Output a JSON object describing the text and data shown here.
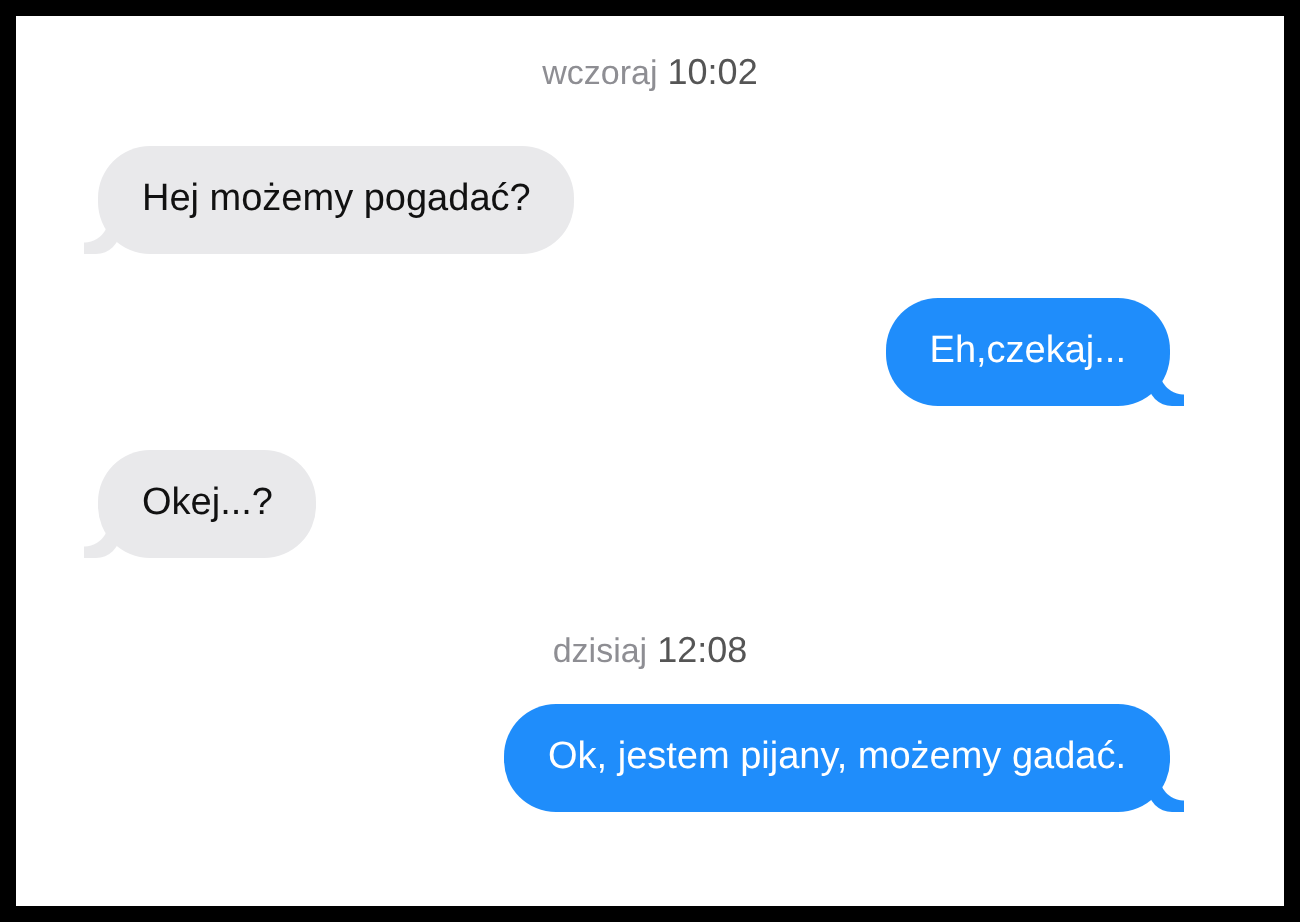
{
  "conversation": [
    {
      "kind": "timestamp",
      "day": "wczoraj",
      "time": "10:02"
    },
    {
      "kind": "incoming",
      "text": "Hej możemy pogadać?"
    },
    {
      "kind": "outgoing",
      "text": "Eh,czekaj..."
    },
    {
      "kind": "incoming",
      "text": "Okej...?"
    },
    {
      "kind": "timestamp",
      "day": "dzisiaj",
      "time": "12:08"
    },
    {
      "kind": "outgoing",
      "text": "Ok, jestem pijany, możemy gadać."
    }
  ]
}
